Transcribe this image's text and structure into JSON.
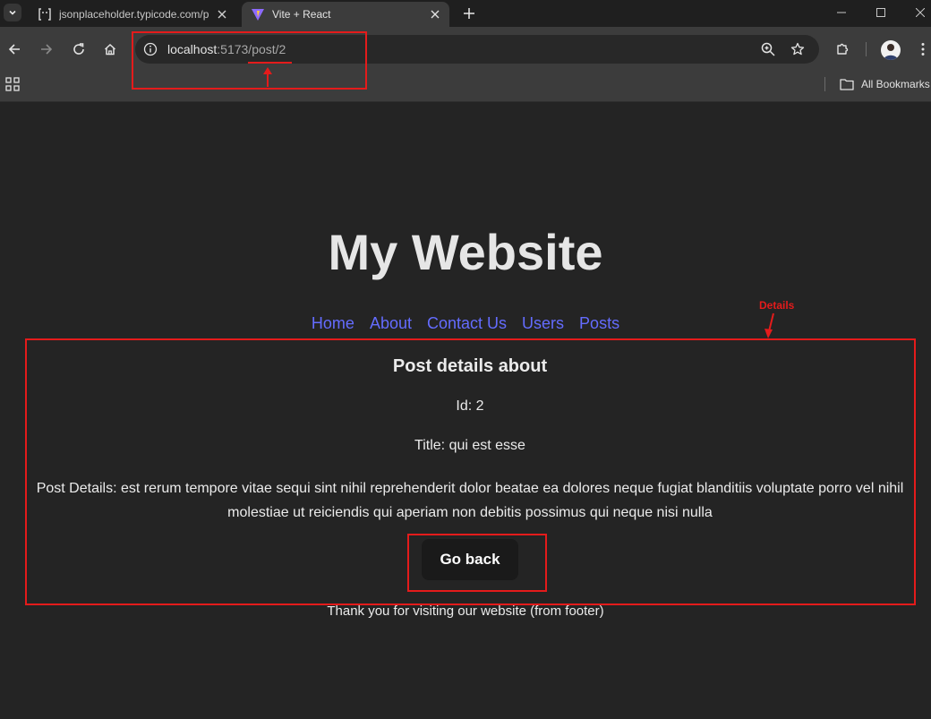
{
  "browser": {
    "tabs": [
      {
        "title": "jsonplaceholder.typicode.com/p",
        "active": false
      },
      {
        "title": "Vite + React",
        "active": true
      }
    ],
    "url_host": "localhost",
    "url_path": ":5173/post/2",
    "bookmarks_label": "All Bookmarks"
  },
  "site": {
    "title": "My Website",
    "nav": [
      "Home",
      "About",
      "Contact Us",
      "Users",
      "Posts"
    ],
    "footer": "Thank you for visiting our website (from footer)"
  },
  "post": {
    "heading": "Post details about",
    "id_line": "Id: 2",
    "title_line": "Title: qui est esse",
    "details_line": "Post Details: est rerum tempore vitae sequi sint nihil reprehenderit dolor beatae ea dolores neque fugiat blanditiis voluptate porro vel nihil molestiae ut reiciendis qui aperiam non debitis possimus qui neque nisi nulla",
    "back_button": "Go back"
  },
  "annotations": {
    "details_label": "Details"
  },
  "colors": {
    "link": "#646cff",
    "annotation": "#e41b1b",
    "background": "#242424"
  }
}
